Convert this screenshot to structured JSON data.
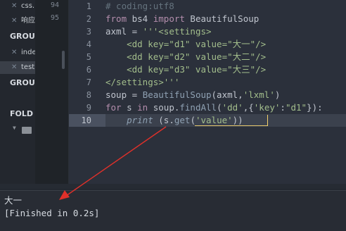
{
  "sidebar": {
    "tabs": [
      {
        "close": "✕",
        "label": "css."
      },
      {
        "close": "✕",
        "label": "响应"
      },
      {
        "close": "✕",
        "label": "inde"
      },
      {
        "close": "✕",
        "label": "test"
      }
    ],
    "headings": [
      "GROU",
      "GROU",
      "FOLD"
    ],
    "folder_icon": "folder-icon"
  },
  "minimap": {
    "numbers": [
      "94",
      "95"
    ]
  },
  "editor": {
    "line_numbers": [
      "1",
      "2",
      "3",
      "4",
      "5",
      "6",
      "7",
      "8",
      "9",
      "10"
    ],
    "lines": [
      [
        {
          "t": "# coding:utf8",
          "c": "c-com"
        }
      ],
      [
        {
          "t": "from",
          "c": "c-kw"
        },
        {
          "t": " bs4 ",
          "c": ""
        },
        {
          "t": "import",
          "c": "c-kw"
        },
        {
          "t": " BeautifulSoup",
          "c": ""
        }
      ],
      [
        {
          "t": "axml = ",
          "c": ""
        },
        {
          "t": "'''<settings>",
          "c": "c-str"
        }
      ],
      [
        {
          "t": "    <dd key=\"d1\" value=\"大一\"/>",
          "c": "c-str"
        }
      ],
      [
        {
          "t": "    <dd key=\"d2\" value=\"大二\"/>",
          "c": "c-str"
        }
      ],
      [
        {
          "t": "    <dd key=\"d3\" value=\"大三\"/>",
          "c": "c-str"
        }
      ],
      [
        {
          "t": "</settings>'''",
          "c": "c-str"
        }
      ],
      [
        {
          "t": "soup = ",
          "c": ""
        },
        {
          "t": "BeautifulSoup",
          "c": "c-fn"
        },
        {
          "t": "(axml,",
          "c": ""
        },
        {
          "t": "'lxml'",
          "c": "c-str"
        },
        {
          "t": ")",
          "c": ""
        }
      ],
      [
        {
          "t": "for",
          "c": "c-kw"
        },
        {
          "t": " s ",
          "c": ""
        },
        {
          "t": "in",
          "c": "c-kw"
        },
        {
          "t": " soup.",
          "c": ""
        },
        {
          "t": "findAll",
          "c": "c-fn"
        },
        {
          "t": "(",
          "c": ""
        },
        {
          "t": "'dd'",
          "c": "c-str"
        },
        {
          "t": ",{",
          "c": ""
        },
        {
          "t": "'key'",
          "c": "c-str"
        },
        {
          "t": ":",
          "c": ""
        },
        {
          "t": "\"d1\"",
          "c": "c-str"
        },
        {
          "t": "}):",
          "c": ""
        }
      ],
      [
        {
          "t": "    ",
          "c": ""
        },
        {
          "t": "print",
          "c": "c-it"
        },
        {
          "t": " (s.",
          "c": ""
        },
        {
          "t": "get",
          "c": "c-fn"
        },
        {
          "t": "(",
          "c": ""
        },
        {
          "t": "'value'",
          "c": "c-str"
        },
        {
          "t": "))",
          "c": ""
        }
      ]
    ]
  },
  "output": {
    "line1": "大一",
    "line2": "[Finished in 0.2s]"
  },
  "colors": {
    "arrow": "#e0302a"
  }
}
